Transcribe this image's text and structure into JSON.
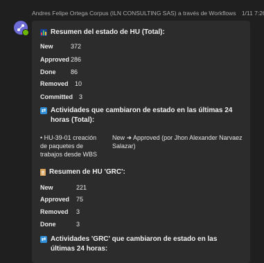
{
  "message": {
    "sender": "Andres Felipe Ortega Corpus (ILN CONSULTING SAS) a través de Workflows",
    "time": "1/11 7:26 a. m."
  },
  "sections": {
    "total": {
      "title": "Resumen del estado de HU (Total):",
      "rows": [
        {
          "label": "New",
          "value": "372"
        },
        {
          "label": "Approved",
          "value": "286"
        },
        {
          "label": "Done",
          "value": "86"
        },
        {
          "label": "Removed",
          "value": "10"
        },
        {
          "label": "Committed",
          "value": "3"
        }
      ]
    },
    "changed_total": {
      "title": "Actividades que cambiaron de estado en las últimas 24 horas (Total):",
      "items": [
        {
          "activity": "• HU-39-01 creación de paquetes de trabajos desde WBS",
          "change": "New ➜ Approved (por Jhon Alexander Narvaez Salazar)"
        }
      ]
    },
    "grc": {
      "title": "Resumen de HU 'GRC':",
      "rows": [
        {
          "label": "New",
          "value": "221"
        },
        {
          "label": "Approved",
          "value": "75"
        },
        {
          "label": "Removed",
          "value": "3"
        },
        {
          "label": "Done",
          "value": "3"
        }
      ]
    },
    "changed_grc": {
      "title": "Actividades 'GRC' que cambiaron de estado en las últimas 24 horas:"
    }
  }
}
